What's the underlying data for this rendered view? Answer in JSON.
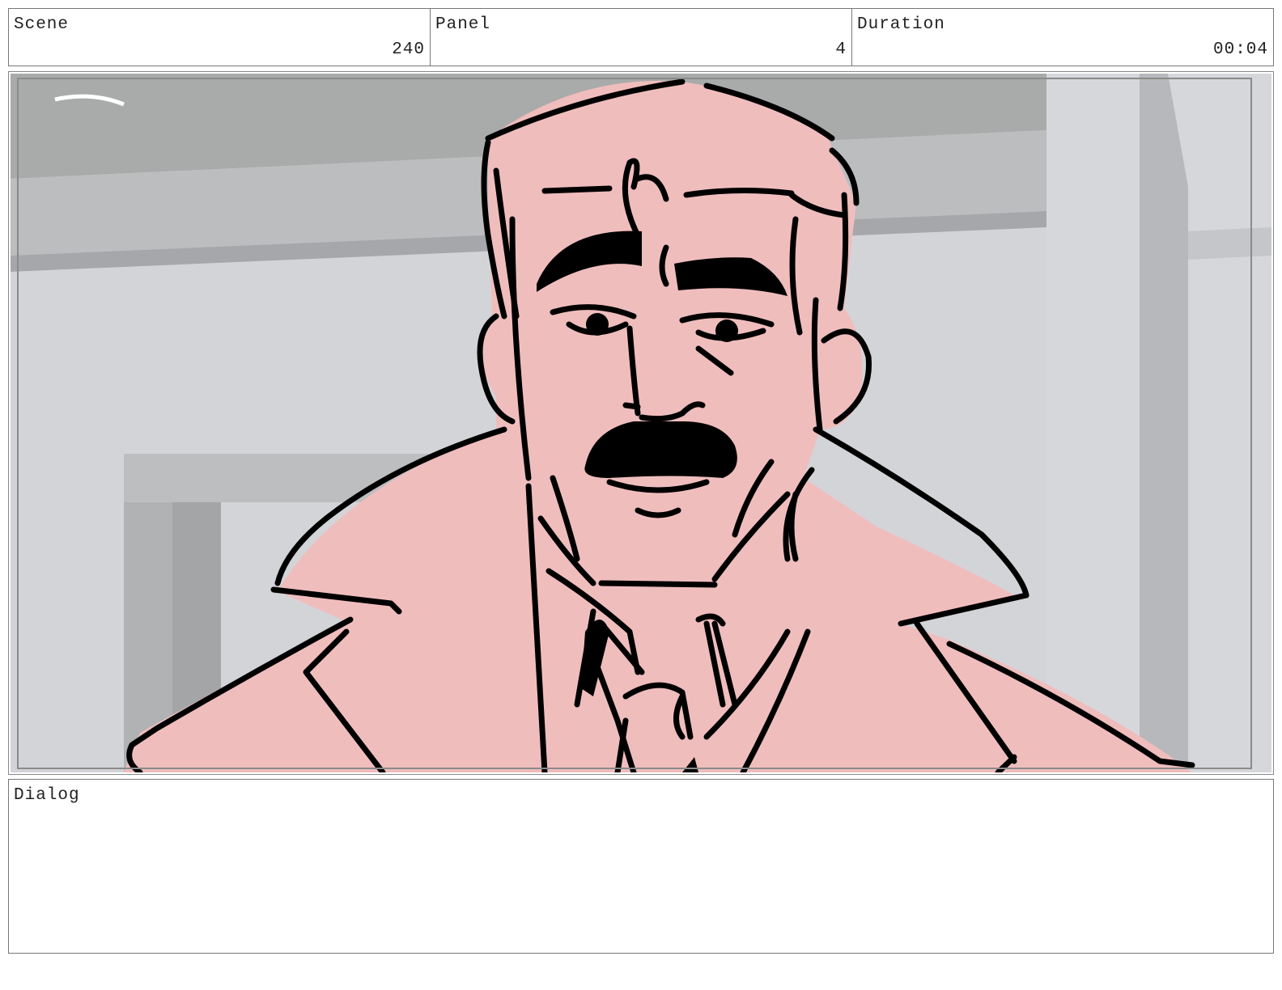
{
  "header": {
    "scene_label": "Scene",
    "scene_value": "240",
    "panel_label": "Panel",
    "panel_value": "4",
    "duration_label": "Duration",
    "duration_value": "00:04"
  },
  "dialog": {
    "label": "Dialog",
    "text": ""
  },
  "colors": {
    "skin_fill": "#f0bdbd",
    "line": "#000000",
    "background_wall": "#d3d4d8",
    "background_ceiling": "#a9abaa"
  }
}
